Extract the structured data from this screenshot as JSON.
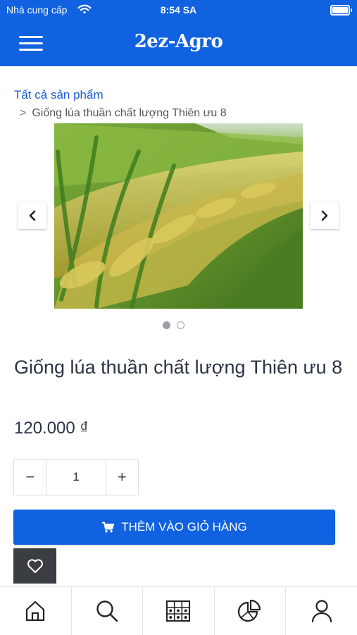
{
  "status_bar": {
    "carrier": "Nhà cung cấp",
    "time": "8:54 SA",
    "icons": [
      "wifi-icon",
      "battery-icon"
    ]
  },
  "header": {
    "brand": "2ez-Agro",
    "menu_icon": "hamburger-icon",
    "background": "#1062e0"
  },
  "breadcrumb": {
    "root": "Tất cả sản phẩm",
    "separator": ">",
    "current": "Giống lúa thuần chất lượng Thiên ưu 8"
  },
  "carousel": {
    "image": "rice-field-photo",
    "slides": 2,
    "active_index": 0,
    "prev_icon": "chevron-left-icon",
    "next_icon": "chevron-right-icon"
  },
  "product": {
    "title": "Giống lúa thuần chất lượng Thiên ưu 8",
    "price": "120.000 ₫"
  },
  "quantity": {
    "minus": "−",
    "value": "1",
    "plus": "+"
  },
  "actions": {
    "add_to_cart": "THÊM VÀO GIỎ HÀNG",
    "cart_icon": "cart-icon",
    "wishlist_icon": "heart-icon"
  },
  "tabs": [
    {
      "icon": "home-icon"
    },
    {
      "icon": "search-icon"
    },
    {
      "icon": "grid-products-icon"
    },
    {
      "icon": "pie-chart-icon"
    },
    {
      "icon": "user-icon"
    }
  ],
  "colors": {
    "primary": "#1062e0",
    "text_dark": "#2b3445",
    "link": "#1a5bd6",
    "wishlist_bg": "#3a3d42"
  }
}
